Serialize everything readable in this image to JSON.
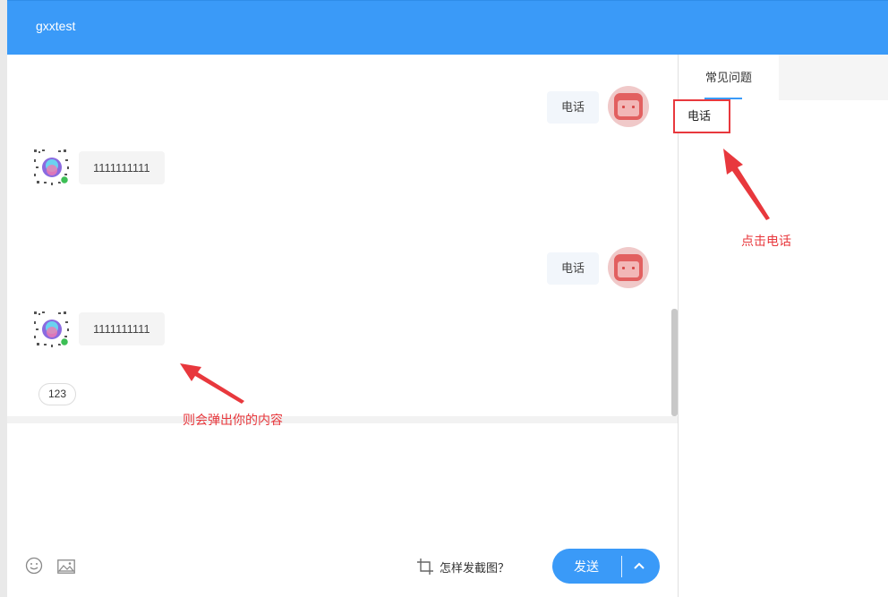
{
  "header": {
    "title": "gxxtest"
  },
  "colors": {
    "primary": "#3a9af8",
    "annotation": "#e8383d"
  },
  "messages": [
    {
      "role": "user",
      "text": "电话"
    },
    {
      "role": "bot",
      "text": "1111111111"
    },
    {
      "role": "user",
      "text": "电话"
    },
    {
      "role": "bot",
      "text": "1111111111"
    }
  ],
  "quick_chip": {
    "label": "123"
  },
  "toolbar": {
    "emoji_icon": "smile-icon",
    "image_icon": "image-icon",
    "screenshot_help": "怎样发截图？",
    "send_label": "发送"
  },
  "sidebar": {
    "tabs": [
      {
        "label": "常见问题",
        "active": true
      }
    ],
    "faq_items": [
      {
        "label": "电话"
      }
    ]
  },
  "annotations": {
    "click_phone": "点击电话",
    "popup_content": "则会弹出你的内容"
  }
}
